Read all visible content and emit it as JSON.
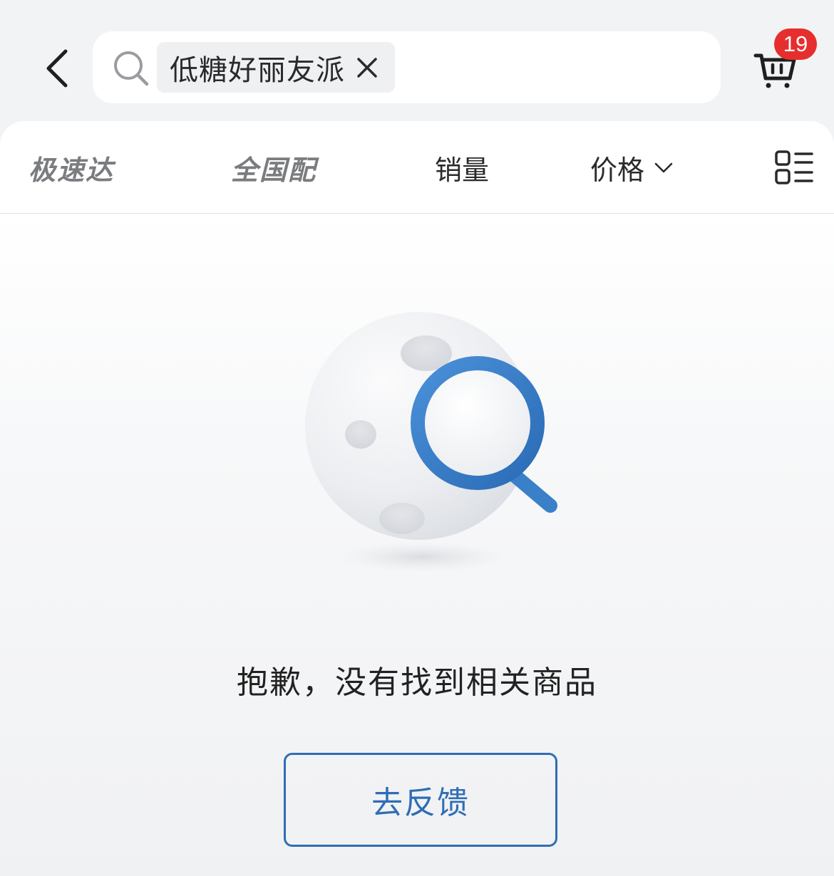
{
  "search": {
    "query_chip": "低糖好丽友派"
  },
  "cart": {
    "badge_count": "19"
  },
  "filters": {
    "speedy": "极速达",
    "national": "全国配",
    "sales": "销量",
    "price": "价格"
  },
  "empty_state": {
    "message": "抱歉，没有找到相关商品",
    "feedback_button": "去反馈"
  },
  "colors": {
    "accent_blue": "#2f6db5",
    "badge_red": "#e62e2e",
    "background": "#f2f3f5"
  },
  "icons": {
    "back": "chevron-left-icon",
    "search": "search-icon",
    "clear": "close-icon",
    "cart": "shopping-cart-icon",
    "price_sort": "chevron-down-icon",
    "layout": "grid-list-toggle-icon",
    "illustration": "moon-magnifier-illustration"
  }
}
